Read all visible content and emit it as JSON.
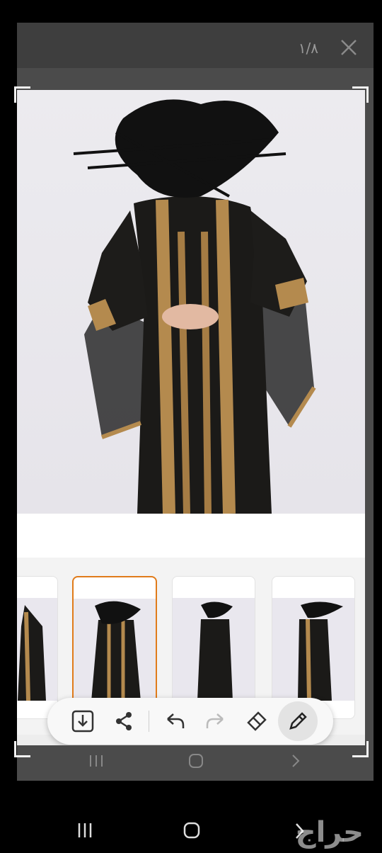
{
  "viewer": {
    "counter": "١/٨",
    "close_icon": "close-icon"
  },
  "thumbnails": [
    {
      "name": "thumb-1",
      "selected": false
    },
    {
      "name": "thumb-2",
      "selected": true
    },
    {
      "name": "thumb-3",
      "selected": false
    },
    {
      "name": "thumb-4",
      "selected": false
    }
  ],
  "toolbar": {
    "tools": [
      "download-icon",
      "share-icon",
      "undo-icon",
      "redo-icon",
      "eraser-icon",
      "pen-icon"
    ]
  },
  "system_nav": {
    "buttons": [
      "recents-icon",
      "home-icon",
      "back-icon"
    ]
  },
  "watermark": {
    "text": "حراج"
  },
  "colors": {
    "accent": "#e07b1a",
    "dress": "#1b1a18",
    "gold": "#b48a4e"
  }
}
